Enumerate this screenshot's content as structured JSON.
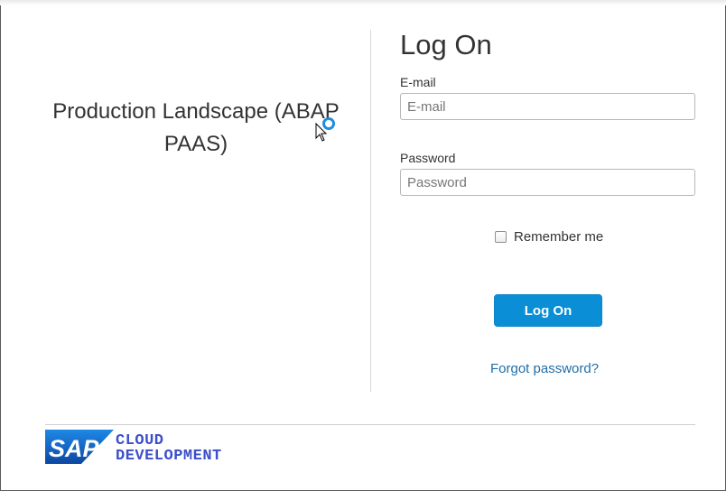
{
  "landscape": {
    "title": "Production Landscape (ABAP PAAS)"
  },
  "login": {
    "heading": "Log On",
    "email_label": "E-mail",
    "email_placeholder": "E-mail",
    "email_value": "",
    "password_label": "Password",
    "password_placeholder": "Password",
    "password_value": "",
    "remember_label": "Remember me",
    "remember_checked": false,
    "button_label": "Log On",
    "forgot_label": "Forgot password?"
  },
  "footer": {
    "logo_text": "SAP",
    "product_line1": "CLOUD",
    "product_line2": "DEVELOPMENT"
  },
  "colors": {
    "accent": "#0a8fd6",
    "link": "#1f6ea8",
    "sap_blue": "#1565c0",
    "product_text": "#3b4fc8"
  },
  "icons": {
    "cursor": "busy-cursor-icon",
    "checkbox": "checkbox-icon"
  }
}
